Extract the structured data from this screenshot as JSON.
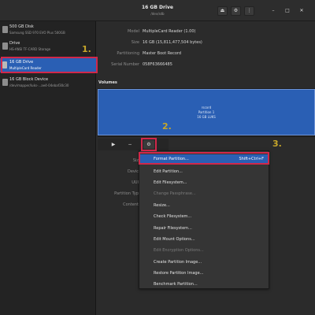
{
  "window": {
    "title": "16 GB Drive",
    "subtitle": "/dev/sdb"
  },
  "titlebar": {
    "power_glyph": "⏏",
    "settings_glyph": "⚙",
    "menu_glyph": "⋮",
    "minimize_glyph": "–",
    "maximize_glyph": "□",
    "close_glyph": "✕"
  },
  "sidebar": {
    "drives": [
      {
        "name": "500 GB Disk",
        "desc": "Samsung SSD 970 EVO Plus 500GB",
        "icon": "disk-icon"
      },
      {
        "name": "Drive",
        "desc": "HS-ANSI TF-CARD Storage",
        "icon": "drive-icon"
      },
      {
        "name": "16 GB Drive",
        "desc": "MultipleCard Reader",
        "icon": "sd-card-icon"
      },
      {
        "name": "16 GB Block Device",
        "desc": "/dev/mapper/luks-...ae4-04ebaf30c30",
        "icon": "block-device-icon"
      }
    ]
  },
  "properties": {
    "model_label": "Model",
    "model_value": "MultipleCard  Reader (1.00)",
    "size_label": "Size",
    "size_value": "16 GB (15,811,477,504 bytes)",
    "partitioning_label": "Partitioning",
    "partitioning_value": "Master Boot Record",
    "serial_label": "Serial Number",
    "serial_value": "058F63666485"
  },
  "volumes": {
    "heading": "Volumes",
    "partition_name": "Partition 1",
    "partition_label": "rscord",
    "partition_size": "16 GB LUKS"
  },
  "volume_toolbar": {
    "play_glyph": "▶",
    "minus_glyph": "−",
    "gears_glyph": "⚙"
  },
  "details": {
    "size_label": "Siz",
    "device_label": "Devic",
    "uuid_label": "UUI",
    "partition_type_label": "Partition Typ",
    "contents_label": "Content"
  },
  "context_menu": {
    "items": [
      {
        "label": "Format Partition...",
        "shortcut": "Shift+Ctrl+F",
        "enabled": true,
        "highlighted": true
      },
      {
        "label": "Edit Partition...",
        "shortcut": "",
        "enabled": true
      },
      {
        "label": "Edit Filesystem...",
        "shortcut": "",
        "enabled": true
      },
      {
        "label": "Change Passphrase...",
        "shortcut": "",
        "enabled": false
      },
      {
        "label": "Resize...",
        "shortcut": "",
        "enabled": true
      },
      {
        "label": "Check Filesystem...",
        "shortcut": "",
        "enabled": true
      },
      {
        "label": "Repair Filesystem...",
        "shortcut": "",
        "enabled": true
      },
      {
        "label": "Edit Mount Options...",
        "shortcut": "",
        "enabled": true
      },
      {
        "label": "Edit Encryption Options...",
        "shortcut": "",
        "enabled": false
      },
      {
        "label": "Create Partition Image...",
        "shortcut": "",
        "enabled": true
      },
      {
        "label": "Restore Partition Image...",
        "shortcut": "",
        "enabled": true
      },
      {
        "label": "Benchmark Partition...",
        "shortcut": "",
        "enabled": true
      }
    ]
  },
  "annotations": {
    "step1": "1.",
    "step2": "2.",
    "step3": "3.",
    "highlight_color": "#d0284a",
    "label_color": "#c7a72a"
  },
  "colors": {
    "accent": "#2a5fb4",
    "window_bg": "#2b2b2b",
    "sidebar_bg": "#232323"
  }
}
